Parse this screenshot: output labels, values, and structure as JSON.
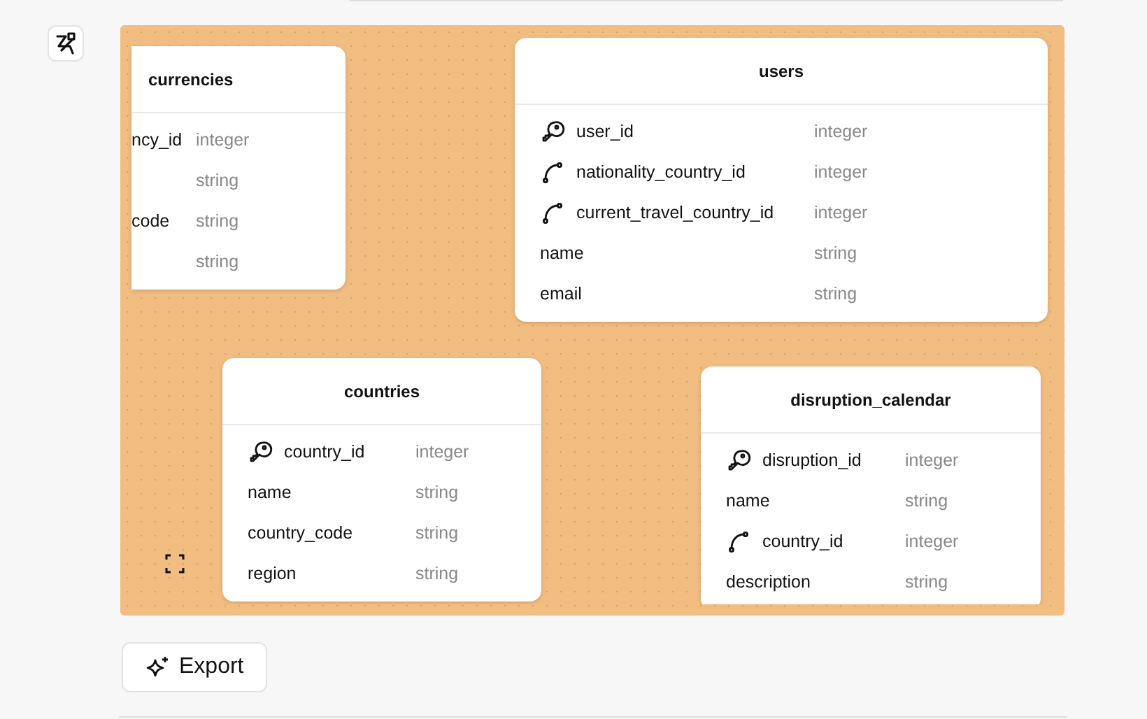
{
  "canvas": {
    "tables": [
      {
        "title": "currencies",
        "fields": [
          {
            "kind": "plain",
            "name": "ncy_id",
            "type": "integer"
          },
          {
            "kind": "plain",
            "type": "string"
          },
          {
            "kind": "plain",
            "name": "code",
            "type": "string"
          },
          {
            "kind": "plain",
            "type": "string"
          }
        ]
      },
      {
        "title": "users",
        "fields": [
          {
            "kind": "pk",
            "name": "user_id",
            "type": "integer"
          },
          {
            "kind": "fk",
            "name": "nationality_country_id",
            "type": "integer"
          },
          {
            "kind": "fk",
            "name": "current_travel_country_id",
            "type": "integer"
          },
          {
            "kind": "plain",
            "name": "name",
            "type": "string"
          },
          {
            "kind": "plain",
            "name": "email",
            "type": "string"
          }
        ]
      },
      {
        "title": "countries",
        "fields": [
          {
            "kind": "pk",
            "name": "country_id",
            "type": "integer"
          },
          {
            "kind": "plain",
            "name": "name",
            "type": "string"
          },
          {
            "kind": "plain",
            "name": "country_code",
            "type": "string"
          },
          {
            "kind": "plain",
            "name": "region",
            "type": "string"
          }
        ]
      },
      {
        "title": "disruption_calendar",
        "fields": [
          {
            "kind": "pk",
            "name": "disruption_id",
            "type": "integer"
          },
          {
            "kind": "plain",
            "name": "name",
            "type": "string"
          },
          {
            "kind": "fk",
            "name": "country_id",
            "type": "integer"
          },
          {
            "kind": "plain",
            "name": "description",
            "type": "string"
          }
        ]
      }
    ]
  },
  "export_button": {
    "label": "Export"
  }
}
